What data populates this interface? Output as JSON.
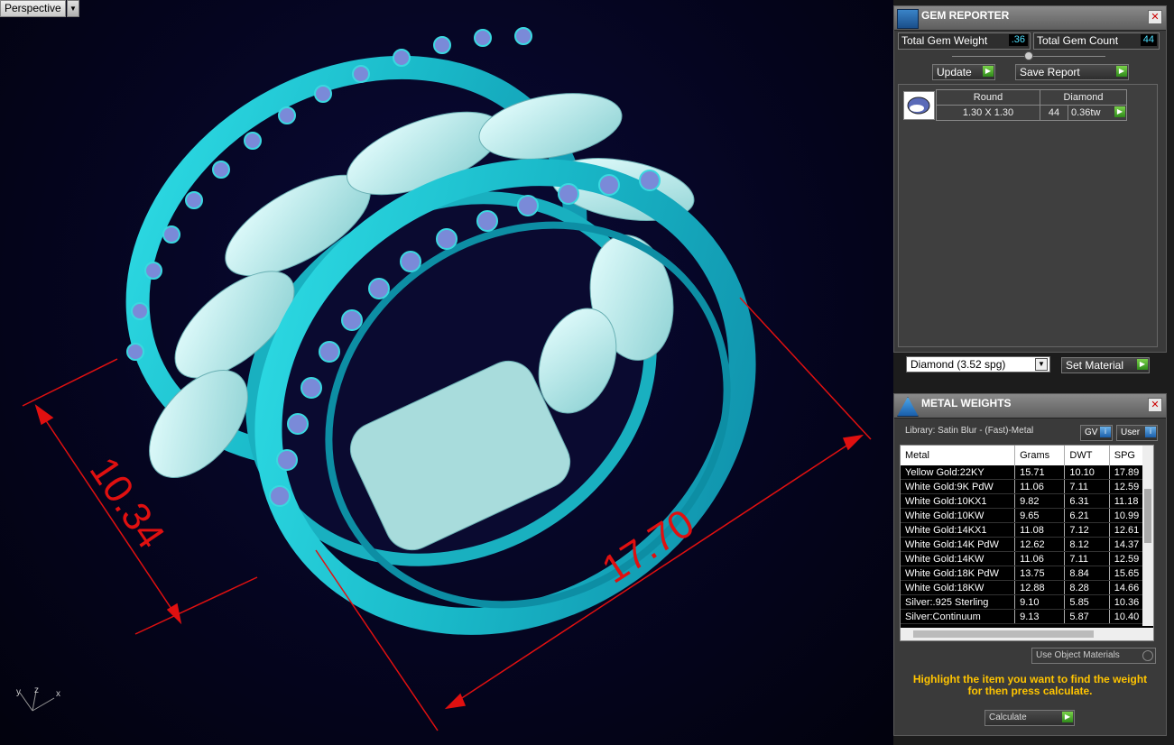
{
  "viewport": {
    "label": "Perspective",
    "dimensions": [
      "10.34",
      "17.70"
    ],
    "axes": {
      "y": "y",
      "z": "z",
      "x": "x"
    }
  },
  "gem_reporter": {
    "title": "GEM REPORTER",
    "total_gem_weight_label": "Total Gem Weight",
    "total_gem_weight": ".36",
    "total_gem_count_label": "Total Gem Count",
    "total_gem_count": "44",
    "update_label": "Update",
    "save_report_label": "Save Report",
    "table": {
      "headers": [
        "Round",
        "Diamond"
      ],
      "row": {
        "size": "1.30 X 1.30",
        "count": "44",
        "weight": "0.36tw"
      }
    },
    "material_select": "Diamond    (3.52 spg)",
    "set_material_label": "Set Material"
  },
  "metal_weights": {
    "title": "METAL WEIGHTS",
    "library": "Library: Satin Blur - (Fast)-Metal",
    "gv_label": "GV",
    "user_label": "User",
    "columns": [
      "Metal",
      "Grams",
      "DWT",
      "SPG"
    ],
    "rows": [
      [
        "Yellow Gold:22KY",
        "15.71",
        "10.10",
        "17.89"
      ],
      [
        "White Gold:9K PdW",
        "11.06",
        "7.11",
        "12.59"
      ],
      [
        "White Gold:10KX1",
        "9.82",
        "6.31",
        "11.18"
      ],
      [
        "White Gold:10KW",
        "9.65",
        "6.21",
        "10.99"
      ],
      [
        "White Gold:14KX1",
        "11.08",
        "7.12",
        "12.61"
      ],
      [
        "White Gold:14K PdW",
        "12.62",
        "8.12",
        "14.37"
      ],
      [
        "White Gold:14KW",
        "11.06",
        "7.11",
        "12.59"
      ],
      [
        "White Gold:18K PdW",
        "13.75",
        "8.84",
        "15.65"
      ],
      [
        "White Gold:18KW",
        "12.88",
        "8.28",
        "14.66"
      ],
      [
        "Silver:.925 Sterling",
        "9.10",
        "5.85",
        "10.36"
      ],
      [
        "Silver:Continuum",
        "9.13",
        "5.87",
        "10.40"
      ]
    ],
    "use_object_materials": "Use Object Materials",
    "hint_line1": "Highlight the item you want to find the weight",
    "hint_line2": "for then press calculate.",
    "calculate_label": "Calculate"
  },
  "colors": {
    "ring": "#22c8d4",
    "chain": "#bdf0ee",
    "dimension": "#e01010",
    "accent_text": "#ffc400"
  }
}
